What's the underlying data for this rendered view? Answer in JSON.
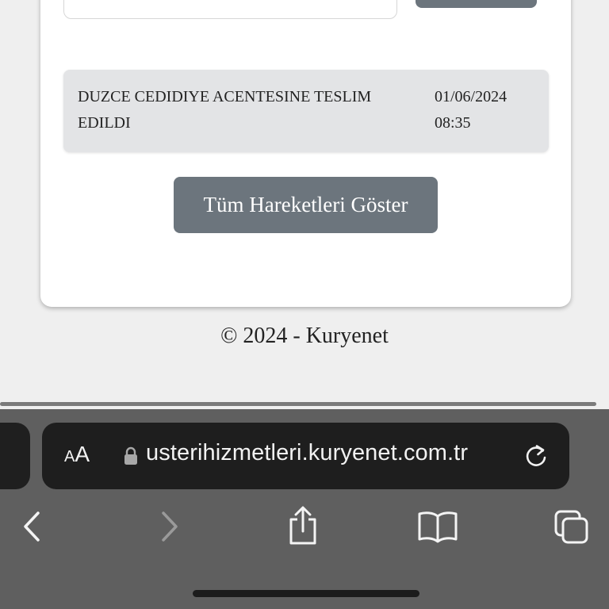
{
  "shipment_event": {
    "description": "DUZCE CEDIDIYE ACENTESINE TESLIM EDILDI",
    "date": "01/06/2024",
    "time": "08:35"
  },
  "show_all_button_label": "Tüm Hareketleri Göster",
  "footer_text": "© 2024 - Kuryenet",
  "browser": {
    "aa_label_small": "A",
    "aa_label_large": "A",
    "url": "usterihizmetleri.kuryenet.com.tr"
  },
  "colors": {
    "button_bg": "#6c757d",
    "event_bg": "#e3e4e6",
    "browser_bg": "#5f5f5f",
    "address_bg": "#1e1e1e"
  },
  "icons": [
    "lock-icon",
    "reload-icon",
    "back-icon",
    "forward-icon",
    "share-icon",
    "bookmarks-icon",
    "tabs-icon"
  ]
}
